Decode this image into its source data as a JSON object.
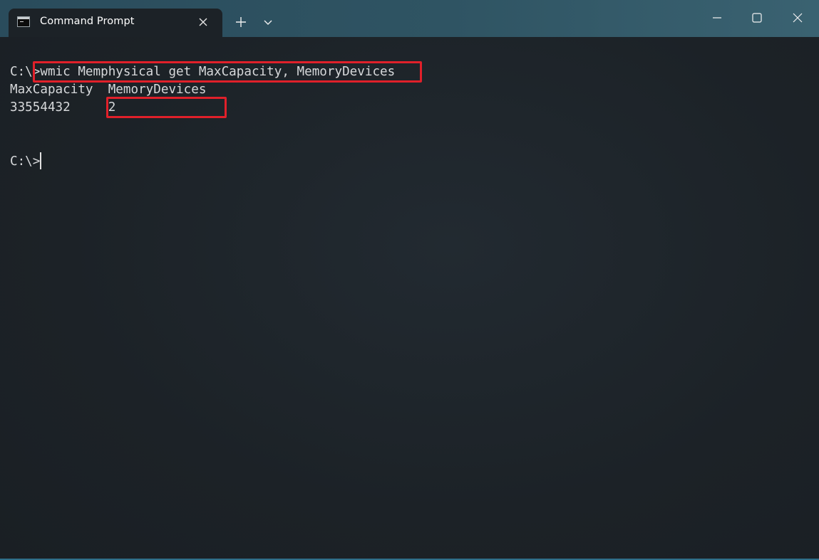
{
  "window": {
    "tab_title": "Command Prompt",
    "icons": {
      "tab": "cmd-icon",
      "close_tab": "close-icon",
      "new_tab": "plus-icon",
      "dropdown": "chevron-down-icon",
      "minimize": "minimize-icon",
      "maximize": "maximize-icon",
      "close_window": "close-icon"
    }
  },
  "terminal": {
    "command_prompt": "C:\\>",
    "command_text": "wmic Memphysical get MaxCapacity, MemoryDevices",
    "header_col1": "MaxCapacity",
    "header_col2": "MemoryDevices",
    "value_col1": "33554432",
    "value_col2": "2",
    "final_prompt": "C:\\>"
  },
  "colors": {
    "titlebar": "#2f5463",
    "terminal_bg": "#1c2227",
    "text": "#d6d8da",
    "highlight": "#e0202a"
  }
}
